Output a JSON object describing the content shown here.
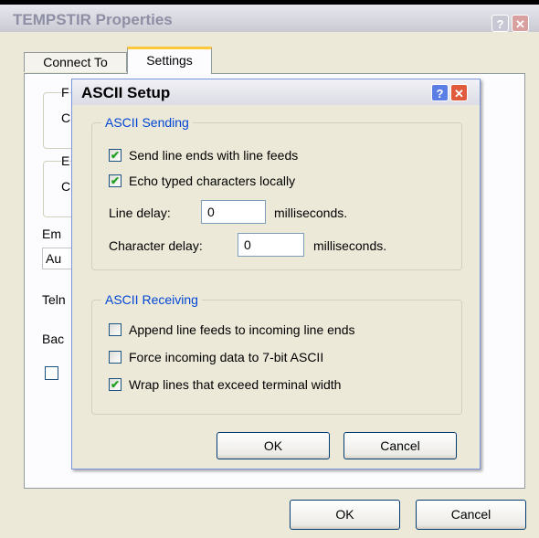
{
  "outer_window": {
    "title": "TEMPSTIR Properties",
    "help_glyph": "?",
    "close_glyph": "✕",
    "tabs": [
      {
        "label": "Connect To",
        "selected": false
      },
      {
        "label": "Settings",
        "selected": true
      }
    ],
    "partial_labels": {
      "group1_letter": "F",
      "group1_radio": "C",
      "group2_letter": "E",
      "group2_radio": "C",
      "emulation": "Em",
      "emulation_value": "Au",
      "telnet": "Teln",
      "backscroll": "Bac"
    },
    "ok_label": "OK",
    "cancel_label": "Cancel"
  },
  "dialog": {
    "title": "ASCII Setup",
    "help_glyph": "?",
    "close_glyph": "✕",
    "sending": {
      "title": "ASCII Sending",
      "send_line_ends": {
        "label": "Send line ends with line feeds",
        "checked": true
      },
      "echo_typed": {
        "label": "Echo typed characters locally",
        "checked": true
      },
      "line_delay_label": "Line delay:",
      "line_delay_value": "0",
      "line_delay_unit": "milliseconds.",
      "char_delay_label": "Character delay:",
      "char_delay_value": "0",
      "char_delay_unit": "milliseconds."
    },
    "receiving": {
      "title": "ASCII Receiving",
      "append_line_feeds": {
        "label": "Append line feeds to incoming line ends",
        "checked": false
      },
      "force_7bit": {
        "label": "Force incoming data to 7-bit ASCII",
        "checked": false
      },
      "wrap_lines": {
        "label": "Wrap lines that exceed terminal width",
        "checked": true
      }
    },
    "ok_label": "OK",
    "cancel_label": "Cancel"
  },
  "check_glyph": "✔"
}
